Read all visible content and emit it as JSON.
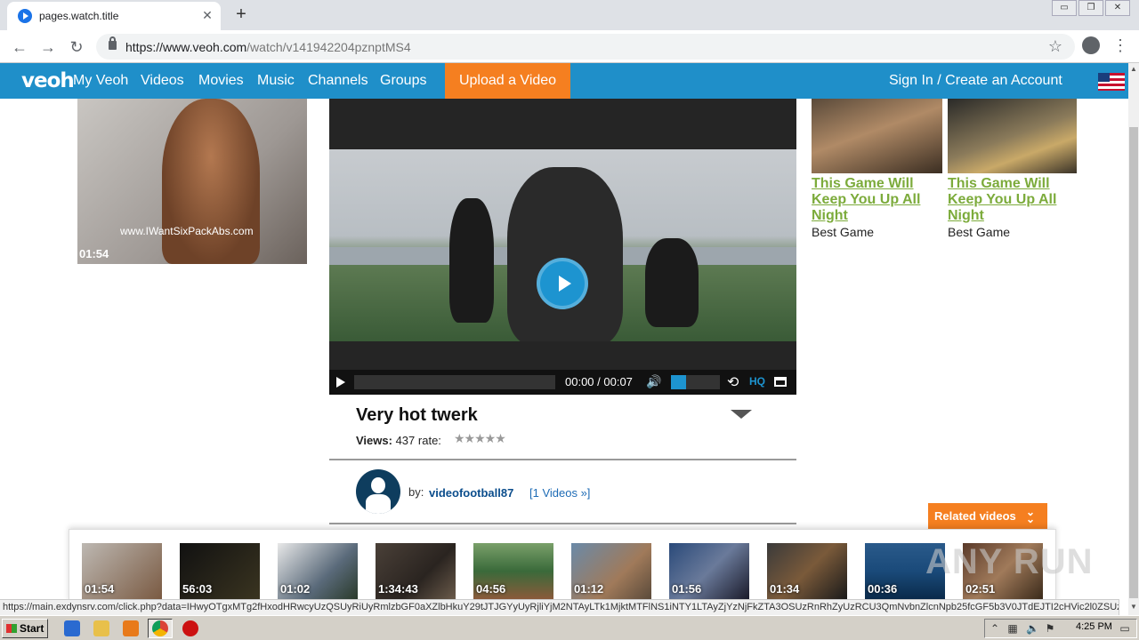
{
  "browser": {
    "tab_title": "pages.watch.title",
    "tab_close": "✕",
    "new_tab": "+",
    "url_host": "https://www.veoh.com",
    "url_path": "/watch/v141942204pznptMS4",
    "window_controls": [
      "▭",
      "❐",
      "✕"
    ]
  },
  "site": {
    "logo": "veoh",
    "nav": [
      "My Veoh",
      "Videos",
      "Movies",
      "Music",
      "Channels",
      "Groups"
    ],
    "upload": "Upload a Video",
    "signin": "Sign In / Create an Account",
    "accent": "#1f8fc9",
    "orange": "#f57f20"
  },
  "left_video": {
    "watermark": "www.IWantSixPackAbs.com",
    "duration": "01:54"
  },
  "player": {
    "time": "00:00 / 00:07",
    "hq": "HQ",
    "volume_fraction": 0.3
  },
  "video": {
    "title": "Very hot twerk",
    "views_label": "Views:",
    "views": "437",
    "rate_label": "rate:",
    "stars": "★★★★★",
    "by": "by:",
    "user": "videofootball87",
    "user_videos": "[1 Videos »]"
  },
  "ads": [
    {
      "title": "This Game Will Keep You Up All Night",
      "sub": "Best Game"
    },
    {
      "title": "This Game Will Keep You Up All Night",
      "sub": "Best Game"
    }
  ],
  "related": {
    "label": "Related videos",
    "items": [
      {
        "duration": "01:54"
      },
      {
        "duration": "56:03"
      },
      {
        "duration": "01:02"
      },
      {
        "duration": "1:34:43"
      },
      {
        "duration": "04:56"
      },
      {
        "duration": "01:12"
      },
      {
        "duration": "01:56"
      },
      {
        "duration": "01:34"
      },
      {
        "duration": "00:36"
      },
      {
        "duration": "02:51"
      }
    ]
  },
  "watermark": "ANY RUN",
  "status_url": "https://main.exdynsrv.com/click.php?data=IHwyOTgxMTg2fHxodHRwcyUzQSUyRiUyRmlzbGF0aXZlbHkuY29tJTJGYyUyRjliYjM2NTAyLTk1MjktMTFlNS1iNTY1LTAyZjYzNjFkZTA3OSUzRnRhZyUzRCU3QmNvbnZlcnNpb25fcGF5b3V0JTdEJTI2cHVic2l0ZSUzRCU...",
  "taskbar": {
    "start": "Start",
    "clock": "4:25 PM"
  }
}
